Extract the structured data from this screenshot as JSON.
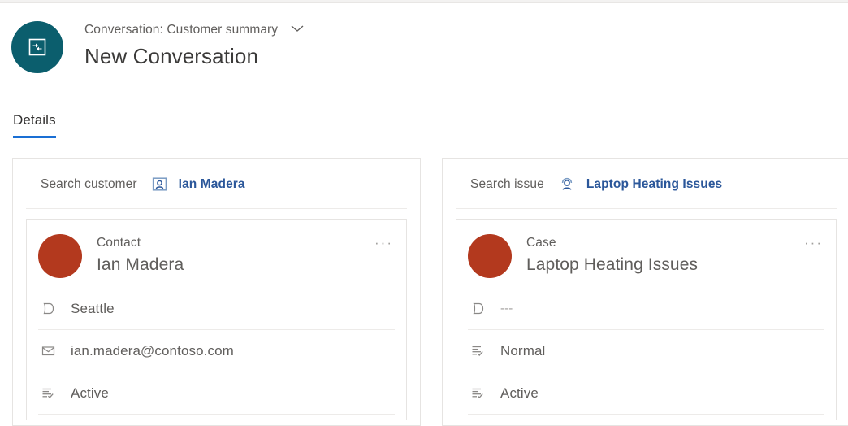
{
  "header": {
    "avatar_icon": "conversation-session-icon",
    "subtitle": "Conversation: Customer summary",
    "chevron_icon": "chevron-down-icon",
    "title": "New Conversation"
  },
  "tabs": [
    {
      "label": "Details",
      "active": true
    }
  ],
  "cards": [
    {
      "search": {
        "label": "Search customer",
        "icon": "contact-card-icon",
        "value": "Ian Madera",
        "value_color": "#2b579a"
      },
      "entity": {
        "avatar_color": "#b3391e",
        "type": "Contact",
        "name": "Ian Madera",
        "overflow_label": "···",
        "fields": [
          {
            "icon": "tag-icon",
            "value": "Seattle",
            "muted": false
          },
          {
            "icon": "envelope-icon",
            "value": "ian.madera@contoso.com",
            "muted": false
          },
          {
            "icon": "status-list-icon",
            "value": "Active",
            "muted": false
          }
        ]
      }
    },
    {
      "search": {
        "label": "Search issue",
        "icon": "case-agent-icon",
        "value": "Laptop Heating Issues",
        "value_color": "#2b579a"
      },
      "entity": {
        "avatar_color": "#b3391e",
        "type": "Case",
        "name": "Laptop Heating Issues",
        "overflow_label": "···",
        "fields": [
          {
            "icon": "tag-icon",
            "value": "---",
            "muted": true
          },
          {
            "icon": "status-list-icon",
            "value": "Normal",
            "muted": false
          },
          {
            "icon": "status-list-icon",
            "value": "Active",
            "muted": false
          }
        ]
      }
    }
  ],
  "colors": {
    "accent_blue": "#1a6fd4",
    "link_blue": "#2b579a",
    "avatar_teal": "#0b5e6d",
    "avatar_rust": "#b3391e"
  }
}
